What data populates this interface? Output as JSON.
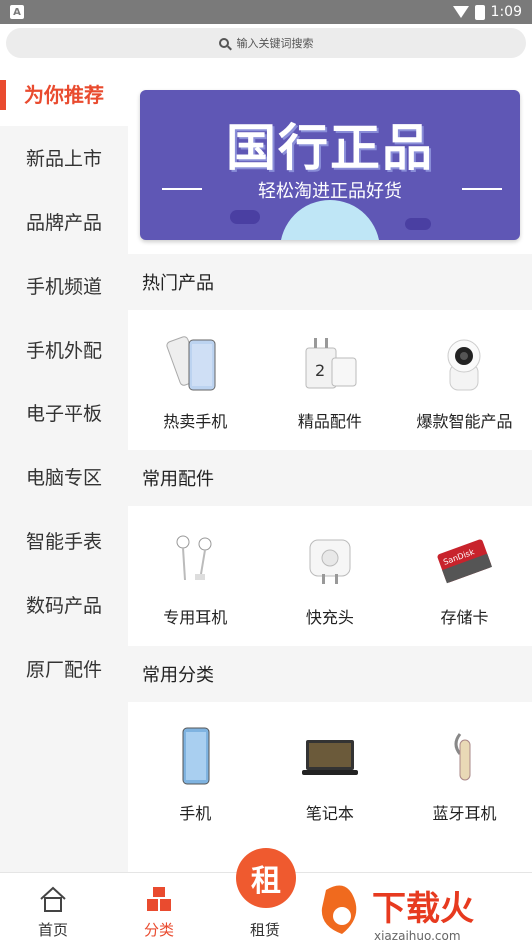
{
  "status": {
    "time": "1:09"
  },
  "search": {
    "placeholder": "输入关键词搜索"
  },
  "sidebar": {
    "items": [
      {
        "label": "为你推荐"
      },
      {
        "label": "新品上市"
      },
      {
        "label": "品牌产品"
      },
      {
        "label": "手机频道"
      },
      {
        "label": "手机外配"
      },
      {
        "label": "电子平板"
      },
      {
        "label": "电脑专区"
      },
      {
        "label": "智能手表"
      },
      {
        "label": "数码产品"
      },
      {
        "label": "原厂配件"
      }
    ]
  },
  "banner": {
    "title": "国行正品",
    "subtitle": "轻松淘进正品好货"
  },
  "sections": [
    {
      "title": "热门产品",
      "items": [
        {
          "label": "热卖手机",
          "icon": "phone-icon"
        },
        {
          "label": "精品配件",
          "icon": "charger-icon"
        },
        {
          "label": "爆款智能产品",
          "icon": "camera-icon"
        }
      ]
    },
    {
      "title": "常用配件",
      "items": [
        {
          "label": "专用耳机",
          "icon": "earphones-icon"
        },
        {
          "label": "快充头",
          "icon": "charger-head-icon"
        },
        {
          "label": "存储卡",
          "icon": "sd-card-icon"
        }
      ]
    },
    {
      "title": "常用分类",
      "items": [
        {
          "label": "手机",
          "icon": "smartphone-icon"
        },
        {
          "label": "笔记本",
          "icon": "laptop-icon"
        },
        {
          "label": "蓝牙耳机",
          "icon": "bluetooth-headset-icon"
        }
      ]
    }
  ],
  "tabbar": {
    "items": [
      {
        "label": "首页"
      },
      {
        "label": "分类"
      },
      {
        "label": "租赁"
      }
    ],
    "center_badge": "租"
  },
  "watermark": {
    "brand": "下载火",
    "url": "xiazaihuo.com"
  },
  "colors": {
    "accent": "#e94b2f",
    "banner": "#5f57b5"
  }
}
